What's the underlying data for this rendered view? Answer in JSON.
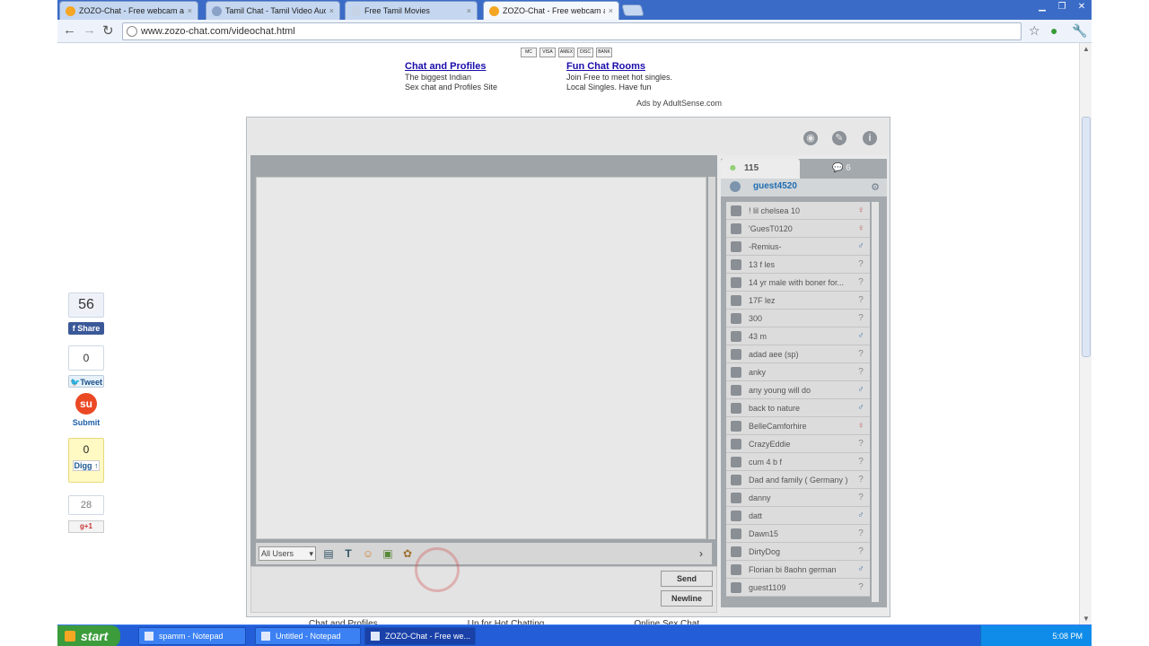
{
  "browser": {
    "tabs": [
      {
        "title": "ZOZO-Chat - Free webcam an",
        "favicon_color": "#f5a623"
      },
      {
        "title": "Tamil Chat - Tamil Video Audio",
        "favicon_color": "#8aa2c8"
      },
      {
        "title": "Free Tamil Movies",
        "favicon_color": "#c6d2e6"
      },
      {
        "title": "ZOZO-Chat - Free webcam an",
        "favicon_color": "#f5a623"
      }
    ],
    "active_tab": 3,
    "url": "www.zozo-chat.com/videochat.html"
  },
  "ads": {
    "cards": [
      "MC",
      "VISA",
      "AMEX",
      "DISC",
      "BANK"
    ],
    "left": {
      "title": "Chat and Profiles",
      "line1": "The biggest Indian",
      "line2": "Sex chat and Profiles Site"
    },
    "right": {
      "title": "Fun Chat Rooms",
      "line1": "Join Free to meet hot singles.",
      "line2": "Local Singles. Have fun"
    },
    "ads_by": "Ads by AdultSense.com"
  },
  "social": {
    "fb_count": "56",
    "fb_label": "Share",
    "tweet_count": "0",
    "tweet_label": "Tweet",
    "stumble_label": "Submit",
    "digg_count": "0",
    "digg_label": "Digg",
    "gplus_count": "28",
    "gplus_label": "+1"
  },
  "chat": {
    "users_tab_count": "115",
    "rooms_tab_count": "6",
    "current_user": "guest4520",
    "target_select": "All Users",
    "send_label": "Send",
    "newline_label": "Newline",
    "users": [
      {
        "name": "! lil chelsea 10",
        "gender": "female"
      },
      {
        "name": "'GuesT0120",
        "gender": "female"
      },
      {
        "name": "-Remius-",
        "gender": "male"
      },
      {
        "name": "13 f les",
        "gender": "unknown"
      },
      {
        "name": "14 yr male with boner for...",
        "gender": "unknown"
      },
      {
        "name": "17F lez",
        "gender": "unknown"
      },
      {
        "name": "300",
        "gender": "unknown"
      },
      {
        "name": "43 m",
        "gender": "male"
      },
      {
        "name": "adad aee (sp)",
        "gender": "unknown"
      },
      {
        "name": "anky",
        "gender": "unknown"
      },
      {
        "name": "any young will do",
        "gender": "male"
      },
      {
        "name": "back to nature",
        "gender": "male"
      },
      {
        "name": "BelleCamforhire",
        "gender": "female"
      },
      {
        "name": "CrazyEddie",
        "gender": "unknown"
      },
      {
        "name": "cum 4 b f",
        "gender": "unknown"
      },
      {
        "name": "Dad and family ( Germany )",
        "gender": "unknown"
      },
      {
        "name": "danny",
        "gender": "unknown"
      },
      {
        "name": "datt",
        "gender": "male"
      },
      {
        "name": "Dawn15",
        "gender": "unknown"
      },
      {
        "name": "DirtyDog",
        "gender": "unknown"
      },
      {
        "name": "Florian bi 8aohn german",
        "gender": "male"
      },
      {
        "name": "guest1109",
        "gender": "unknown"
      }
    ]
  },
  "footer": {
    "links": [
      "Chat and Profiles",
      "Up for Hot Chatting",
      "Online Sex Chat"
    ]
  },
  "taskbar": {
    "start_label": "start",
    "tasks": [
      "spamm - Notepad",
      "Untitled - Notepad",
      "ZOZO-Chat - Free we..."
    ],
    "clock": "5:08 PM"
  }
}
